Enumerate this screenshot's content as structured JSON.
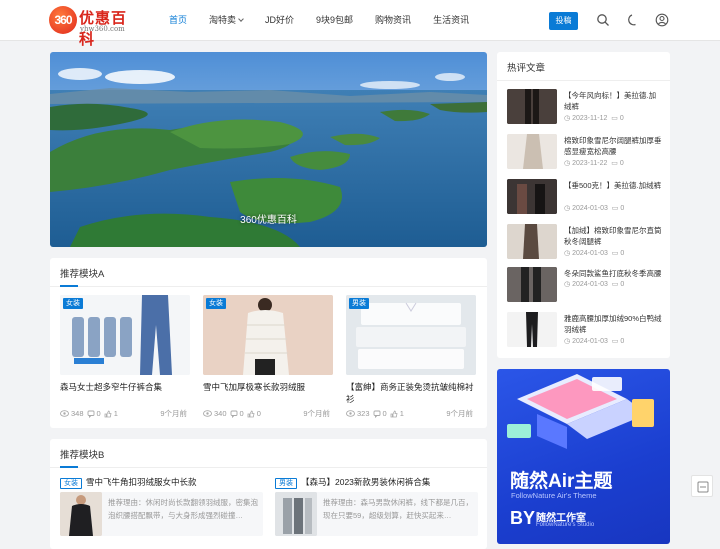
{
  "brand": {
    "badge": "360",
    "name": "优惠百科",
    "domain": "yhw360.com"
  },
  "nav": [
    "首页",
    "淘特卖",
    "JD好价",
    "9块9包邮",
    "购物资讯",
    "生活资讯"
  ],
  "header": {
    "post_label": "投稿"
  },
  "banner": {
    "caption": "360优惠百科"
  },
  "moduleA": {
    "title": "推荐模块A",
    "items": [
      {
        "tag": "女装",
        "title": "森马女士超多窄牛仔裤合集",
        "views": "348",
        "comments": "0",
        "likes": "1",
        "time": "9个月前"
      },
      {
        "tag": "女装",
        "title": "雪中飞加厚极寒长款羽绒服",
        "views": "340",
        "comments": "0",
        "likes": "0",
        "time": "9个月前"
      },
      {
        "tag": "男装",
        "title": "【富绅】商务正装免烫抗皱纯棉衬衫",
        "views": "323",
        "comments": "0",
        "likes": "1",
        "time": "9个月前"
      }
    ]
  },
  "moduleB": {
    "title": "推荐模块B",
    "items": [
      {
        "tag": "女装",
        "title": "雪中飞牛角扣羽绒服女中长款",
        "desc": "推荐理由：休闲时尚长款翻领羽绒服，密集泡泡织腰搭配飘带，与大身形成强烈碰撞…"
      },
      {
        "tag": "男装",
        "title": "【森马】2023新款男装休闲裤合集",
        "desc": "推荐理由：森马男款休闲裤，线下都是几百，现在只要59，超级划算，赶快买起来…"
      }
    ]
  },
  "sidebar": {
    "title": "热评文章",
    "items": [
      {
        "title": "【今年风向标！】美拉德.加绒裤",
        "date": "2023-11-12",
        "comments": "0"
      },
      {
        "title": "棉致印象雪尼尔阔腿裤加厚垂感显瘦宽松高腰",
        "date": "2023-11-22",
        "comments": "0"
      },
      {
        "title": "【垂500克！】美拉德.加绒裤",
        "date": "2024-01-03",
        "comments": "0"
      },
      {
        "title": "【加绒】棉致印象雪尼尔直筒秋冬阔腿裤",
        "date": "2024-01-03",
        "comments": "0"
      },
      {
        "title": "冬朵同款鲨鱼打底秋冬季高腰",
        "date": "2024-01-03",
        "comments": "0"
      },
      {
        "title": "雅鹿高腰加厚加绒90%白鸭绒羽绒裤",
        "date": "2024-01-03",
        "comments": "0"
      }
    ]
  },
  "ad": {
    "title": "随然Air主题",
    "subtitle": "FollowNature Air's Theme",
    "by": "BY",
    "studio": "随然工作室",
    "studio_sub": "FollowNature's Studio"
  },
  "icons": [
    "search-icon",
    "moon-icon",
    "user-icon",
    "eye-icon",
    "comment-icon",
    "thumb-icon",
    "clock-icon",
    "chevron-down-icon"
  ],
  "colors": {
    "accent": "#0a7bd6",
    "brand": "#d9261c",
    "ad_bg": "#2049e0"
  }
}
